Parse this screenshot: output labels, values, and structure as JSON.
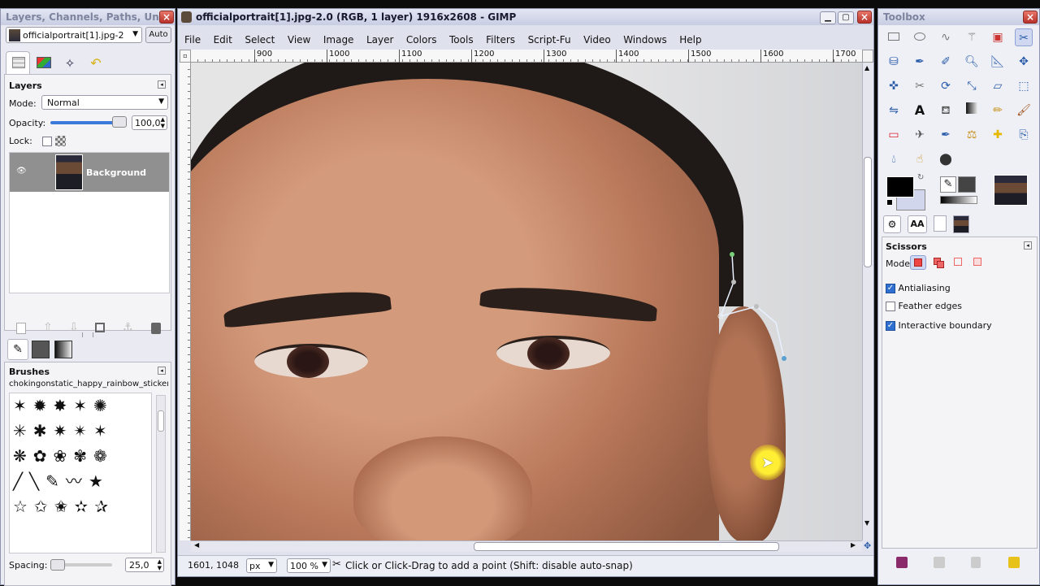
{
  "layers_dock": {
    "title": "Layers, Channels, Paths, Undo - ...",
    "image_select": "officialportrait[1].jpg-2",
    "auto_label": "Auto",
    "layers_heading": "Layers",
    "mode_label": "Mode:",
    "mode_value": "Normal",
    "opacity_label": "Opacity:",
    "opacity_value": "100,0",
    "lock_label": "Lock:",
    "layer_name": "Background",
    "brushes_heading": "Brushes",
    "brush_name": "chokingonstatic_happy_rainbow_stickers.ab...",
    "spacing_label": "Spacing:",
    "spacing_value": "25,0"
  },
  "image_window": {
    "title": "officialportrait[1].jpg-2.0 (RGB, 1 layer) 1916x2608 - GIMP",
    "menu": [
      "File",
      "Edit",
      "Select",
      "View",
      "Image",
      "Layer",
      "Colors",
      "Tools",
      "Filters",
      "Script-Fu",
      "Video",
      "Windows",
      "Help"
    ],
    "ruler_ticks": [
      "900",
      "1000",
      "1100",
      "1200",
      "1300",
      "1400",
      "1500",
      "1600",
      "1700"
    ],
    "coords": "1601, 1048",
    "unit": "px",
    "zoom": "100 %",
    "status_message": "Click or Click-Drag to add a point (Shift: disable auto-snap)"
  },
  "toolbox": {
    "title": "Toolbox",
    "tool_options_heading": "Scissors",
    "mode_label": "Mode:",
    "options": [
      {
        "label": "Antialiasing",
        "checked": true
      },
      {
        "label": "Feather edges",
        "checked": false
      },
      {
        "label": "Interactive boundary",
        "checked": true
      }
    ]
  },
  "colors": {
    "accent": "#2f6fd0",
    "titlebar": "#c9cde3",
    "canvas_bg": "#d9d9dc"
  }
}
